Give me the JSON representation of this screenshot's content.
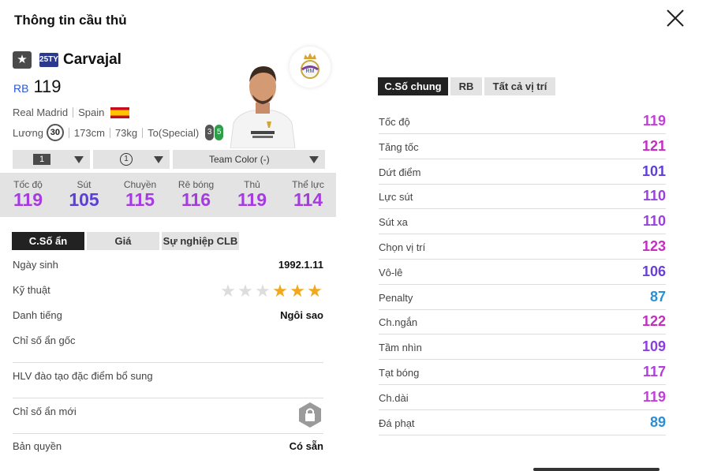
{
  "title": "Thông tin cầu thủ",
  "player": {
    "name": "Carvajal",
    "season_badge": "25TY",
    "position": "RB",
    "ovr": "119",
    "club": "Real Madrid",
    "nation": "Spain",
    "salary_label": "Lương",
    "salary": "30",
    "height": "173cm",
    "weight": "73kg",
    "body_type": "To(Special)",
    "weak_foot_left": "3",
    "weak_foot_right": "5"
  },
  "selectors": {
    "level": "1",
    "boost": "1",
    "team_color": "Team Color (-)"
  },
  "summary_stats": [
    {
      "label": "Tốc độ",
      "value": "119",
      "color": "#a53be0"
    },
    {
      "label": "Sút",
      "value": "105",
      "color": "#5b3fd6"
    },
    {
      "label": "Chuyền",
      "value": "115",
      "color": "#a53be0"
    },
    {
      "label": "Rê bóng",
      "value": "116",
      "color": "#a53be0"
    },
    {
      "label": "Thủ",
      "value": "119",
      "color": "#a53be0"
    },
    {
      "label": "Thể lực",
      "value": "114",
      "color": "#a53be0"
    }
  ],
  "left_tabs": [
    "C.Số ẩn",
    "Giá",
    "Sự nghiệp CLB"
  ],
  "details": {
    "birth_label": "Ngày sinh",
    "birth": "1992.1.11",
    "skill_label": "Kỹ thuật",
    "skill_stars": 3,
    "skill_max": 6,
    "reputation_label": "Danh tiếng",
    "reputation": "Ngôi sao",
    "hidden_orig_label": "Chỉ số ẩn gốc",
    "coach_label": "HLV đào tạo đặc điểm bổ sung",
    "hidden_new_label": "Chỉ số ẩn mới",
    "copyright_label": "Bản quyền",
    "copyright": "Có sẵn"
  },
  "right_tabs": [
    "C.Số chung",
    "RB",
    "Tất cả vị trí"
  ],
  "attributes": [
    {
      "label": "Tốc độ",
      "value": "119",
      "color": "#c33fd9"
    },
    {
      "label": "Tăng tốc",
      "value": "121",
      "color": "#c22fc0"
    },
    {
      "label": "Dứt điểm",
      "value": "101",
      "color": "#5f3fd8"
    },
    {
      "label": "Lực sút",
      "value": "110",
      "color": "#9a3fe0"
    },
    {
      "label": "Sút xa",
      "value": "110",
      "color": "#9a3fe0"
    },
    {
      "label": "Chọn vị trí",
      "value": "123",
      "color": "#c22fc0"
    },
    {
      "label": "Vô-lê",
      "value": "106",
      "color": "#6a3fd8"
    },
    {
      "label": "Penalty",
      "value": "87",
      "color": "#2b8fd6"
    },
    {
      "label": "Ch.ngắn",
      "value": "122",
      "color": "#c22fc0"
    },
    {
      "label": "Tầm nhìn",
      "value": "109",
      "color": "#8a3fe0"
    },
    {
      "label": "Tạt bóng",
      "value": "117",
      "color": "#b03fdc"
    },
    {
      "label": "Ch.dài",
      "value": "119",
      "color": "#c33fd9"
    },
    {
      "label": "Đá phạt",
      "value": "89",
      "color": "#2b8fd6"
    }
  ]
}
